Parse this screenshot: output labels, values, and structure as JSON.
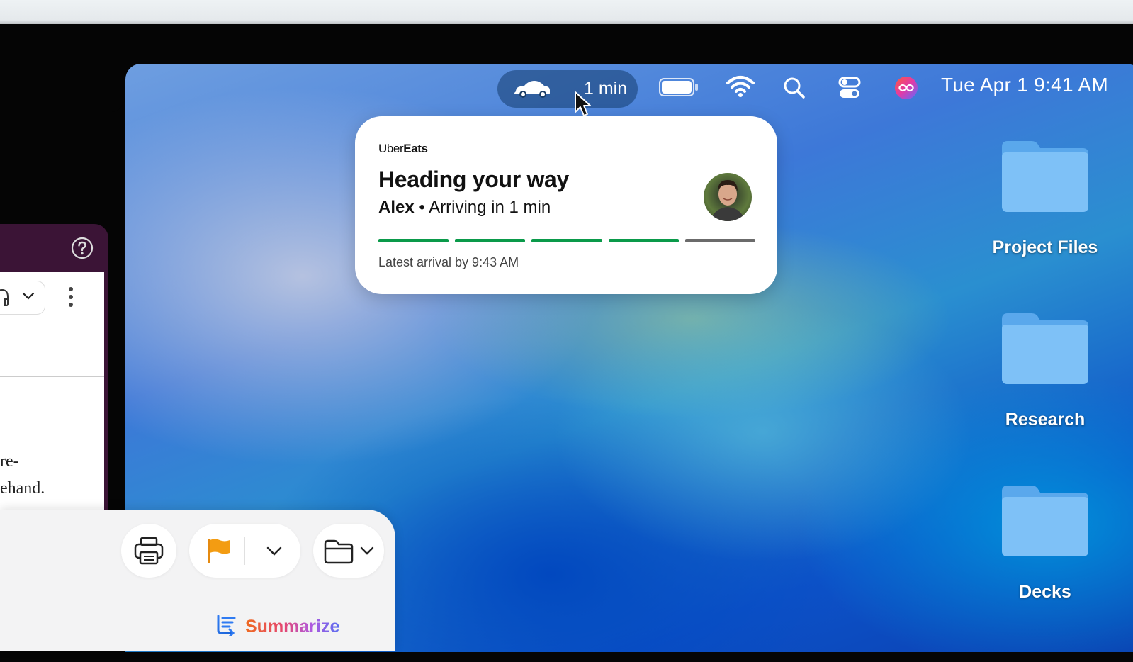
{
  "menubar": {
    "live_activity_eta": "1 min",
    "clock": "Tue Apr 1  9:41 AM",
    "icons": [
      "car-icon",
      "battery-icon",
      "wifi-icon",
      "search-icon",
      "control-center-icon",
      "siri-icon"
    ]
  },
  "notification": {
    "brand_light": "Uber",
    "brand_bold": "Eats",
    "title": "Heading your way",
    "courier": "Alex",
    "separator": "•",
    "status": "Arriving in 1 min",
    "progress_segments_complete": 4,
    "progress_segments_total": 5,
    "footer": "Latest arrival by 9:43 AM",
    "colors": {
      "complete": "#0a9a4a",
      "pending": "#6b6b6b"
    }
  },
  "desktop": {
    "folders": [
      {
        "label": "Project Files"
      },
      {
        "label": "Research"
      },
      {
        "label": "Decks"
      }
    ]
  },
  "app_window": {
    "text_line_1": "re-",
    "text_line_2": "ehand."
  },
  "mail_toolbar": {
    "summarize_label": "Summarize",
    "flag_color": "#f39c12"
  }
}
